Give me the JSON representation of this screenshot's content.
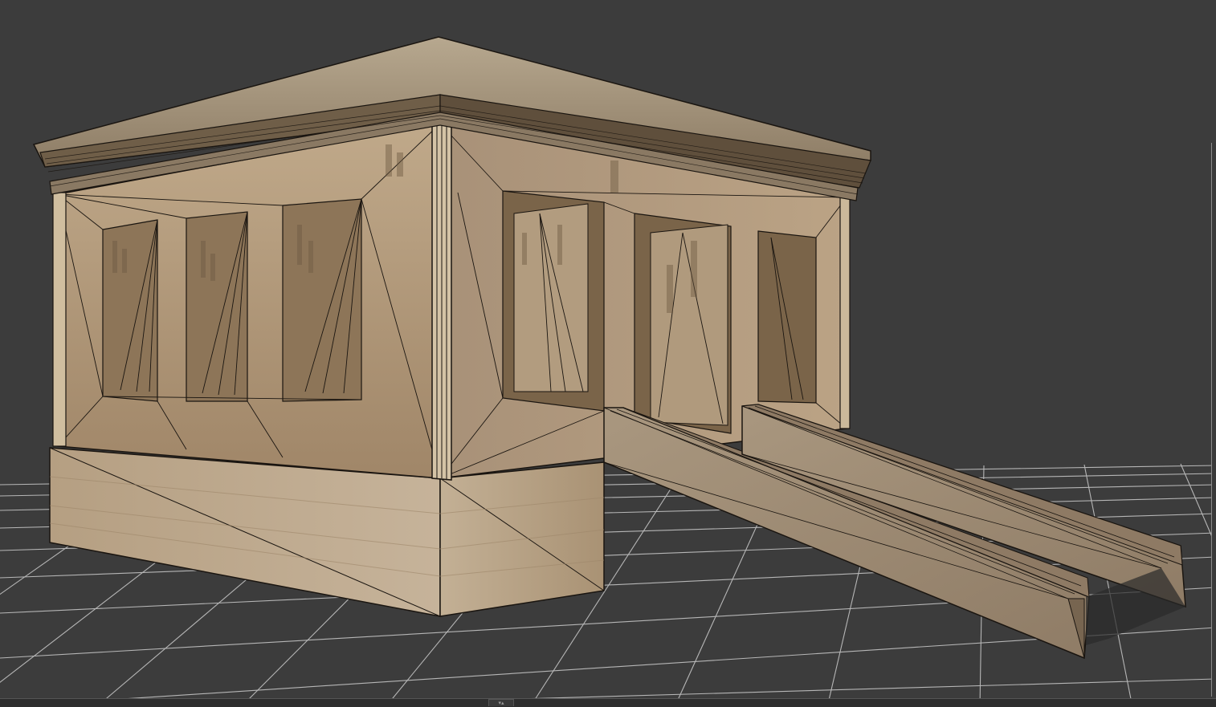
{
  "viewport": {
    "background": "#3c3c3c",
    "grid_color": "#c8c8c8",
    "mode": "shaded-wireframe"
  },
  "model": {
    "subject": "egyptian-kiosk-temple-with-ramps",
    "stone_color": "#b19a7a",
    "edge_color": "#1a1510"
  },
  "bottom_bar": {
    "handle_glyph": "▾▴",
    "handle_icon": "resize-handle-icon"
  }
}
